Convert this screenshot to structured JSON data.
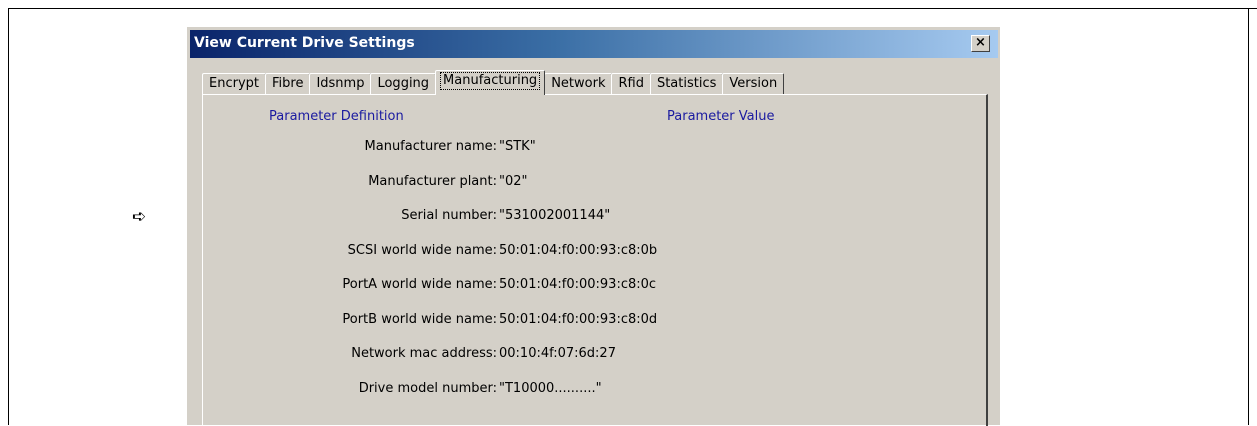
{
  "window": {
    "title": "View Current Drive Settings",
    "close_label": "×"
  },
  "tabs": [
    {
      "label": "Encrypt",
      "active": false
    },
    {
      "label": "Fibre",
      "active": false
    },
    {
      "label": "Idsnmp",
      "active": false
    },
    {
      "label": "Logging",
      "active": false
    },
    {
      "label": "Manufacturing",
      "active": true
    },
    {
      "label": "Network",
      "active": false
    },
    {
      "label": "Rfid",
      "active": false
    },
    {
      "label": "Statistics",
      "active": false
    },
    {
      "label": "Version",
      "active": false
    }
  ],
  "table": {
    "header_definition": "Parameter Definition",
    "header_value": "Parameter Value",
    "rows": [
      {
        "label": "Manufacturer name:",
        "value": "\"STK\""
      },
      {
        "label": "Manufacturer plant:",
        "value": "\"02\""
      },
      {
        "label": "Serial number:",
        "value": "\"531002001144\""
      },
      {
        "label": "SCSI  world wide name:",
        "value": "50:01:04:f0:00:93:c8:0b"
      },
      {
        "label": "PortA world wide name:",
        "value": "50:01:04:f0:00:93:c8:0c"
      },
      {
        "label": "PortB world wide name:",
        "value": "50:01:04:f0:00:93:c8:0d"
      },
      {
        "label": "Network mac address:",
        "value": "00:10:4f:07:6d:27"
      },
      {
        "label": "Drive model number:",
        "value": "\"T10000..........\""
      }
    ]
  },
  "pointer_arrow": "➪",
  "colors": {
    "title_gradient_start": "#0a246a",
    "title_gradient_end": "#a6caf0",
    "dialog_face": "#d4d0c8",
    "header_text": "#1a1aa0"
  }
}
